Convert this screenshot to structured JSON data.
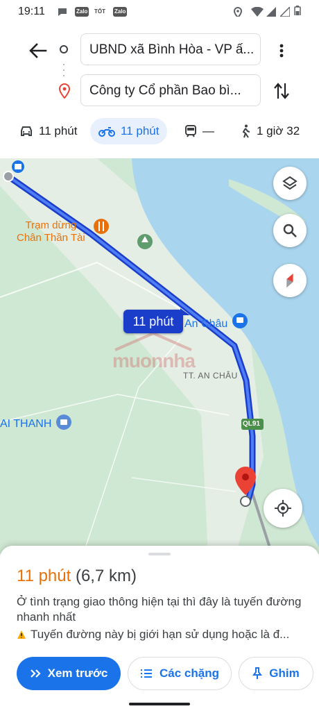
{
  "status_bar": {
    "time": "19:11",
    "apps": [
      "Zalo",
      "TỐT",
      "Zalo"
    ],
    "icons": [
      "message-icon",
      "location-icon",
      "wifi-icon",
      "signal-icon",
      "signal-icon",
      "battery-icon"
    ]
  },
  "search": {
    "origin": "UBND xã Bình Hòa - VP ấ...",
    "destination": "Công ty Cổ phần Bao bì..."
  },
  "modes": [
    {
      "icon": "car-icon",
      "label": "11 phút"
    },
    {
      "icon": "motorbike-icon",
      "label": "11 phút",
      "selected": true
    },
    {
      "icon": "transit-icon",
      "label": "—"
    },
    {
      "icon": "walk-icon",
      "label": "1 giờ 32"
    }
  ],
  "map": {
    "labels": {
      "poi_food": "Trạm dừng\nChân Thần Tài",
      "town_an_chau": "An Châu",
      "tt_an_chau": "TT. AN CHÂU",
      "thanh": "AI THANH",
      "road": "QL91"
    },
    "route_badge": "11 phút",
    "watermark": "muonnha",
    "colors": {
      "route": "#1a3ec9",
      "water": "#a9d5ee",
      "land": "#cfe8d3",
      "pin": "#ea4335"
    }
  },
  "sheet": {
    "duration": "11 phút",
    "distance": "(6,7 km)",
    "description": "Ở tình trạng giao thông hiện tại thì đây là tuyến đường nhanh nhất",
    "warning": "Tuyến đường này bị giới hạn sử dụng hoặc là đ...",
    "buttons": {
      "preview": "Xem trước",
      "steps": "Các chặng",
      "pin": "Ghim"
    }
  }
}
